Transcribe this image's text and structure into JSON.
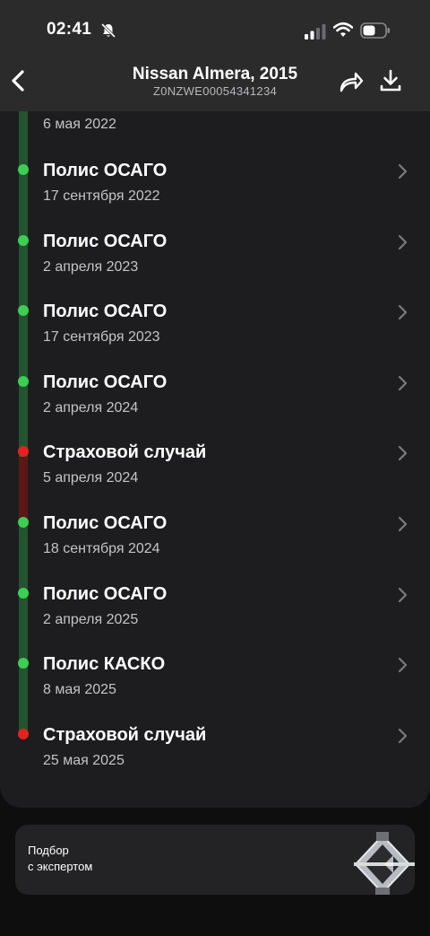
{
  "status_bar": {
    "time": "02:41"
  },
  "header": {
    "title": "Nissan Almera, 2015",
    "subtitle": "Z0NZWE00054341234"
  },
  "timeline": {
    "partial_top_date": "6 мая 2022",
    "events": [
      {
        "title": "Полис ОСАГО",
        "date": "17 сентября 2022",
        "status": "green"
      },
      {
        "title": "Полис ОСАГО",
        "date": "2 апреля 2023",
        "status": "green"
      },
      {
        "title": "Полис ОСАГО",
        "date": "17 сентября 2023",
        "status": "green"
      },
      {
        "title": "Полис ОСАГО",
        "date": "2 апреля 2024",
        "status": "green"
      },
      {
        "title": "Страховой случай",
        "date": "5 апреля 2024",
        "status": "red"
      },
      {
        "title": "Полис ОСАГО",
        "date": "18 сентября 2024",
        "status": "green"
      },
      {
        "title": "Полис ОСАГО",
        "date": "2 апреля 2025",
        "status": "green"
      },
      {
        "title": "Полис КАСКО",
        "date": "8 мая 2025",
        "status": "green"
      },
      {
        "title": "Страховой случай",
        "date": "25 мая 2025",
        "status": "red"
      }
    ]
  },
  "promo": {
    "text": "Подбор\nс экспертом"
  },
  "colors": {
    "green_dot": "#3ccf53",
    "red_dot": "#e8211e",
    "green_line": "#245330",
    "red_line": "#5a1818"
  },
  "icons": {
    "back": "chevron-left-icon",
    "share": "share-arrow-icon",
    "download": "download-icon",
    "row_chevron": "chevron-right-icon",
    "promo_image": "car-jack-icon"
  }
}
